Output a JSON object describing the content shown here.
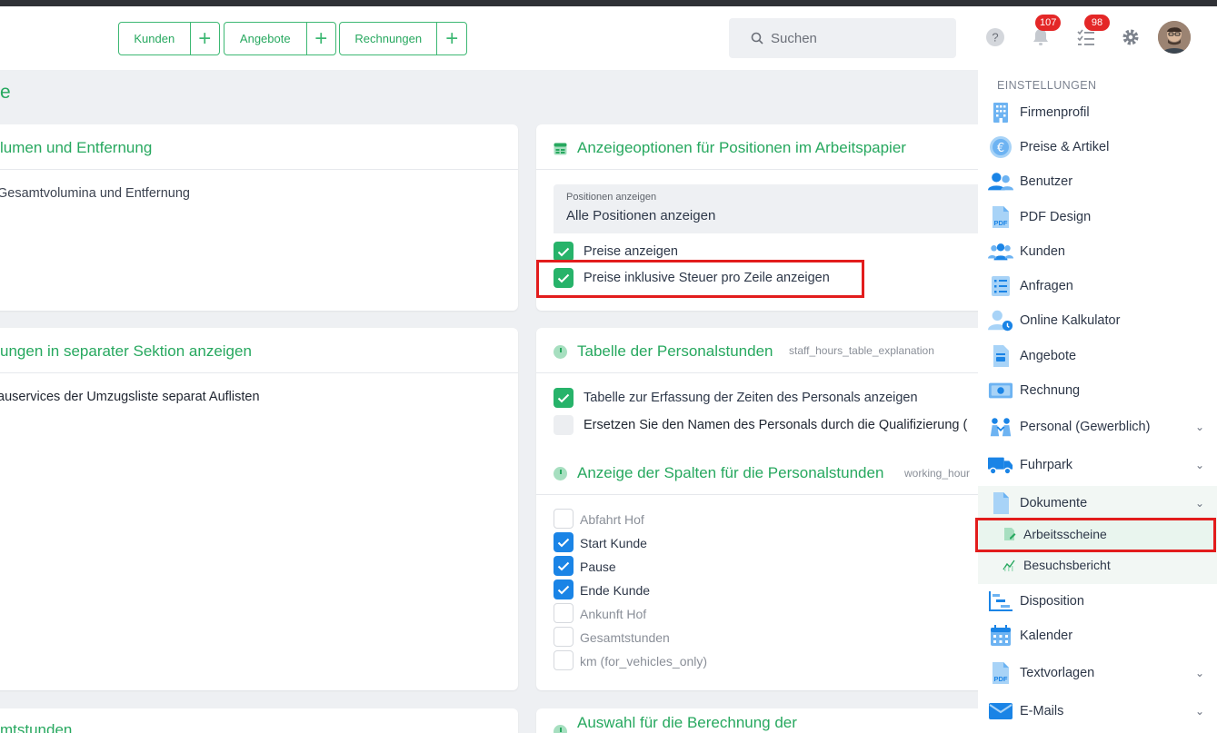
{
  "header": {
    "quick_buttons": [
      {
        "label": "Kunden"
      },
      {
        "label": "Angebote"
      },
      {
        "label": "Rechnungen"
      }
    ],
    "search_placeholder": "Suchen",
    "notifications_count": "107",
    "tasks_count": "98"
  },
  "page": {
    "title_fragment": "e"
  },
  "cards": {
    "volumes": {
      "title": "lumen und Entfernung",
      "text": "Gesamtvolumina und Entfernung"
    },
    "separate": {
      "title": "ungen in separater Sektion anzeigen",
      "text": "auservices der Umzugsliste separat Auflisten"
    },
    "bottom_left": {
      "title": "mtstunden"
    },
    "display_options": {
      "title": "Anzeigeoptionen für Positionen im Arbeitspapier",
      "field_label": "Positionen anzeigen",
      "field_value": "Alle Positionen anzeigen",
      "checkbox_prices": "Preise anzeigen",
      "checkbox_prices_tax": "Preise inklusive Steuer pro Zeile anzeigen"
    },
    "staff_hours": {
      "title": "Tabelle der Personalstunden",
      "subtitle": "staff_hours_table_explanation",
      "checkbox_show_table": "Tabelle zur Erfassung der Zeiten des Personals anzeigen",
      "checkbox_replace_names": "Ersetzen Sie den Namen des Personals durch die Qualifizierung (",
      "columns_title": "Anzeige der Spalten für die Personalstunden",
      "columns_subtitle": "working_hour",
      "columns": [
        {
          "label": "Abfahrt Hof",
          "checked": false
        },
        {
          "label": "Start Kunde",
          "checked": true
        },
        {
          "label": "Pause",
          "checked": true
        },
        {
          "label": "Ende Kunde",
          "checked": true
        },
        {
          "label": "Ankunft Hof",
          "checked": false
        },
        {
          "label": "Gesamtstunden",
          "checked": false
        },
        {
          "label": "km (for_vehicles_only)",
          "checked": false
        }
      ]
    },
    "calc": {
      "title": "Auswahl für die Berechnung der"
    }
  },
  "sidebar": {
    "section_label": "EINSTELLUNGEN",
    "items": [
      {
        "label": "Firmenprofil"
      },
      {
        "label": "Preise & Artikel"
      },
      {
        "label": "Benutzer"
      },
      {
        "label": "PDF Design"
      },
      {
        "label": "Kunden"
      },
      {
        "label": "Anfragen"
      },
      {
        "label": "Online Kalkulator"
      },
      {
        "label": "Angebote"
      },
      {
        "label": "Rechnung"
      },
      {
        "label": "Personal (Gewerblich)"
      },
      {
        "label": "Fuhrpark"
      },
      {
        "label": "Dokumente"
      },
      {
        "label": "Disposition"
      },
      {
        "label": "Kalender"
      },
      {
        "label": "Textvorlagen"
      },
      {
        "label": "E-Mails"
      }
    ],
    "sub_items": [
      {
        "label": "Arbeitsscheine"
      },
      {
        "label": "Besuchsbericht"
      }
    ]
  },
  "colors": {
    "accent_green": "#27a85f",
    "checkbox_blue": "#1a84e6",
    "highlight_red": "#e21c1c",
    "badge_red": "#e42727"
  }
}
